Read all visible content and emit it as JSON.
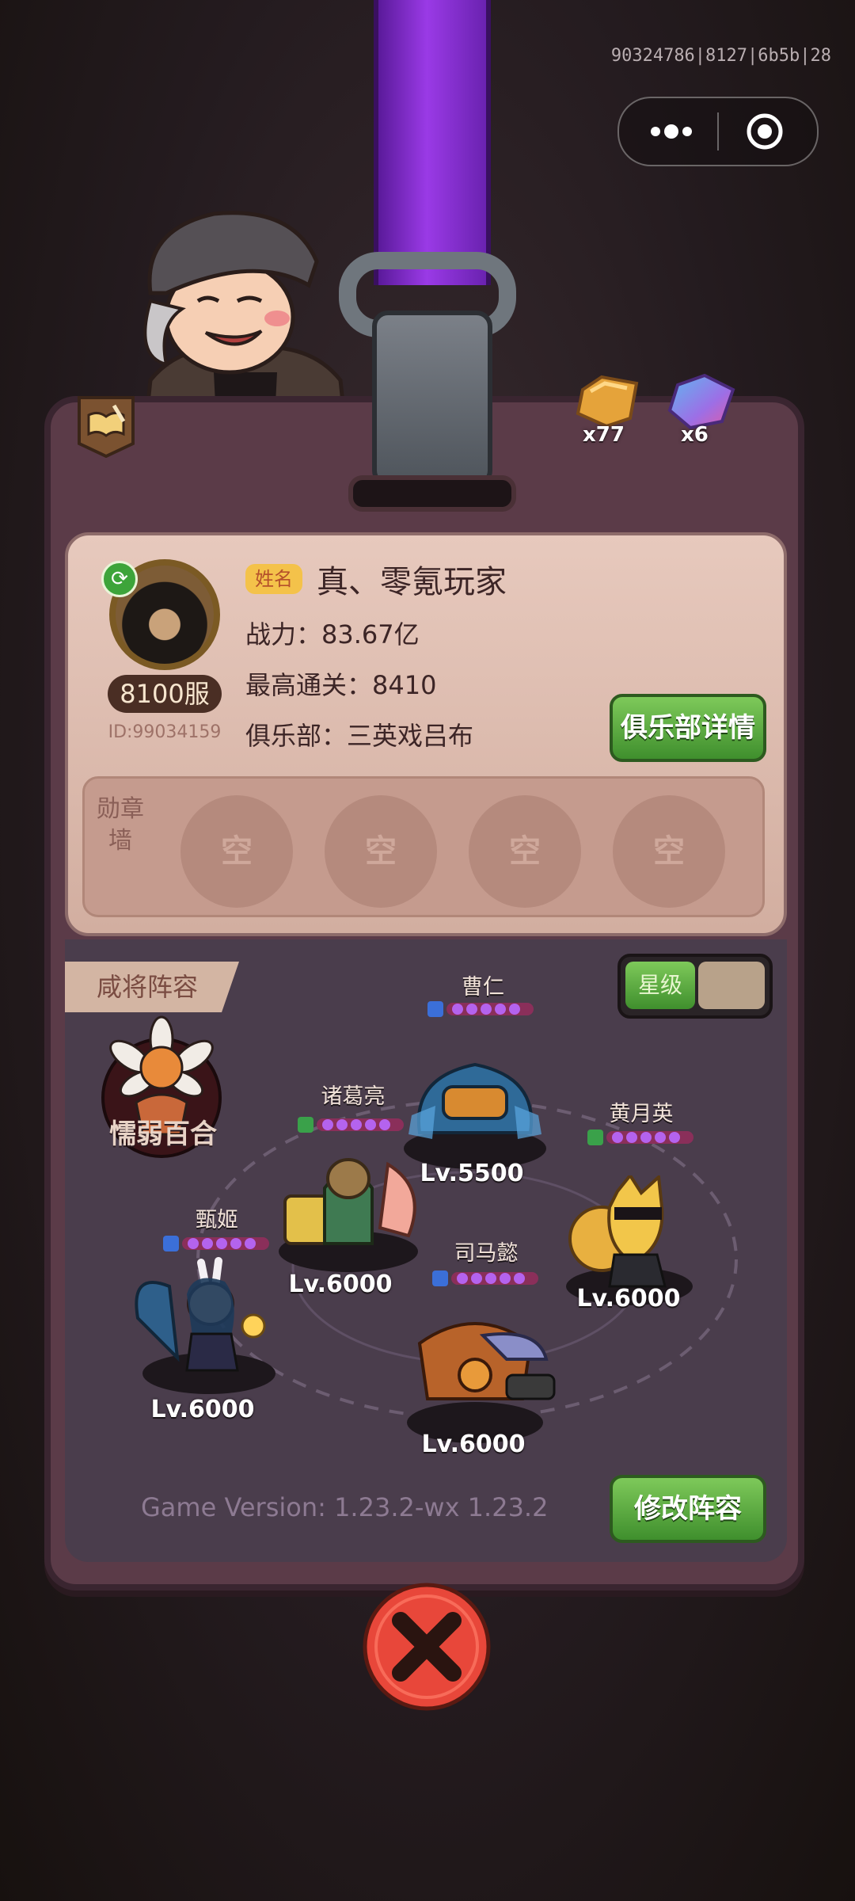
{
  "topbar": {
    "session_id": "90324786|8127|6b5b|28"
  },
  "currency": {
    "gold_count": "x77",
    "purple_count": "x6"
  },
  "profile": {
    "name_tag": "姓名",
    "name": "真、零氪玩家",
    "power": "战力：83.67亿",
    "best_clear": "最高通关：8410",
    "club": "俱乐部：三英戏吕布",
    "server": "8100服",
    "player_id": "ID:99034159",
    "club_button": "俱乐部详情"
  },
  "medal_wall": {
    "label": "勋章墙",
    "slots": [
      "空",
      "空",
      "空",
      "空"
    ]
  },
  "lineup": {
    "title": "咸将阵容",
    "star_toggle_label": "星级",
    "ally_name": "懦弱百合",
    "heroes": [
      {
        "name": "曹仁",
        "level": "Lv.5500",
        "faction": "魏"
      },
      {
        "name": "诸葛亮",
        "level": "Lv.6000",
        "faction": "蜀"
      },
      {
        "name": "黄月英",
        "level": "Lv.6000",
        "faction": "蜀"
      },
      {
        "name": "甄姬",
        "level": "Lv.6000",
        "faction": "魏"
      },
      {
        "name": "司马懿",
        "level": "Lv.6000",
        "faction": "魏"
      }
    ],
    "edit_button": "修改阵容"
  },
  "footer": {
    "version": "Game Version: 1.23.2-wx 1.23.2"
  },
  "colors": {
    "accent_green": "#3f8f2d",
    "lanyard_purple": "#9a3ae6",
    "close_red": "#e8473a"
  }
}
